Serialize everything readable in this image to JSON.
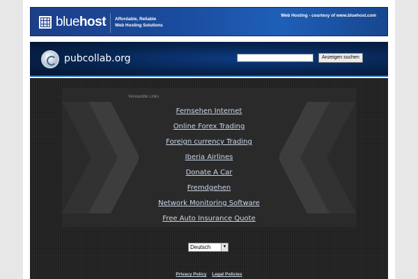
{
  "bluehost_banner": {
    "brand_part1": "blue",
    "brand_part2": "host",
    "tagline_line1": "Affordable, Reliable",
    "tagline_line2": "Web Hosting Solutions",
    "courtesy_text": "Web Hosting - courtesy of www.bluehost.com"
  },
  "header": {
    "site_title": "pubcollab.org",
    "search": {
      "value": "",
      "placeholder": ""
    },
    "search_button_label": "Anzeigen suchen"
  },
  "related": {
    "label": "Verwandte Links",
    "links": [
      "Fernsehen Internet",
      "Online Forex Trading",
      "Foreign currency Trading",
      "Iberia Airlines",
      "Donate A Car",
      "Fremdgehen",
      "Network Monitoring Software",
      "Free Auto Insurance Quote"
    ]
  },
  "language_select": {
    "selected": "Deutsch",
    "arrow_icon": "chevron-down-icon"
  },
  "footer": {
    "privacy_label": "Privacy Policy",
    "legal_label": "Legal Policies"
  },
  "colors": {
    "banner_blue": "#1a4b9d",
    "header_dark_blue": "#07244f",
    "body_dark": "#1f1f1f",
    "link_color": "#c9d7e8"
  }
}
